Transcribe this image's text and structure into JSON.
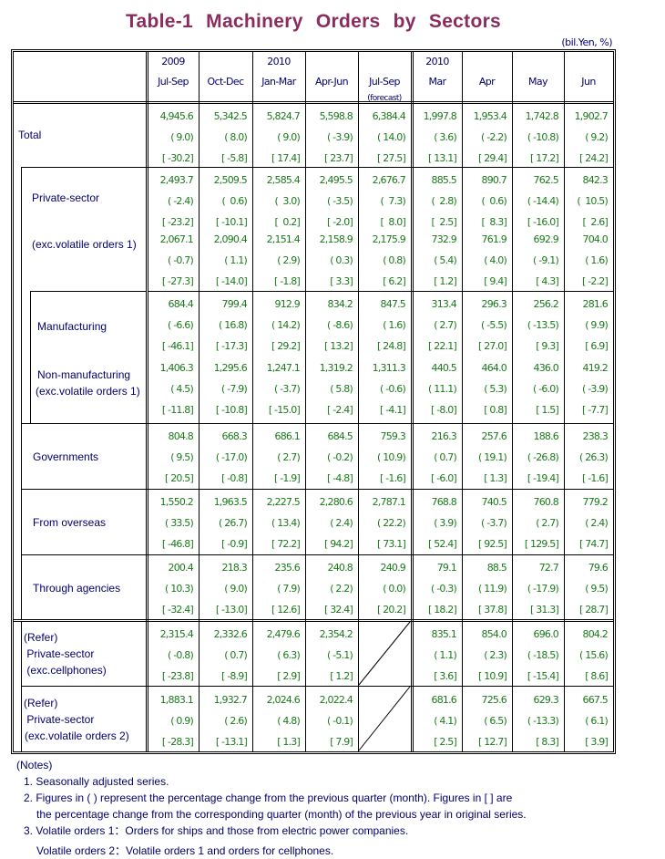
{
  "title": "Table-1  Machinery  Orders  by  Sectors",
  "units": "(bil.Yen, %)",
  "header": {
    "quarters": [
      {
        "year": "2009",
        "label": "Jul-Sep",
        "note": ""
      },
      {
        "year": "",
        "label": "Oct-Dec",
        "note": ""
      },
      {
        "year": "2010",
        "label": "Jan-Mar",
        "note": ""
      },
      {
        "year": "",
        "label": "Apr-Jun",
        "note": ""
      },
      {
        "year": "",
        "label": "Jul-Sep",
        "note": "(forecast)"
      }
    ],
    "months": [
      {
        "year": "2010",
        "label": "Mar"
      },
      {
        "year": "",
        "label": "Apr"
      },
      {
        "year": "",
        "label": "May"
      },
      {
        "year": "",
        "label": "Jun"
      }
    ]
  },
  "rows": [
    {
      "label": [
        "Total"
      ],
      "values": [
        "4,945.6",
        "5,342.5",
        "5,824.7",
        "5,598.8",
        "6,384.4",
        "1,997.8",
        "1,953.4",
        "1,742.8",
        "1,902.7"
      ],
      "qoq": [
        "( 9.0)",
        "( 8.0)",
        "( 9.0)",
        "( -3.9)",
        "( 14.0)",
        "( 3.6)",
        "( -2.2)",
        "( -10.8)",
        "( 9.2)"
      ],
      "yoy": [
        "[ -30.2]",
        "[ -5.8]",
        "[ 17.4]",
        "[ 23.7]",
        "[ 27.5]",
        "[ 13.1]",
        "[ 29.4]",
        "[ 17.2]",
        "[ 24.2]"
      ]
    },
    {
      "label": [
        "Private-sector"
      ],
      "values": [
        "2,493.7",
        "2,509.5",
        "2,585.4",
        "2,495.5",
        "2,676.7",
        "885.5",
        "890.7",
        "762.5",
        "842.3"
      ],
      "qoq": [
        "( -2.4)",
        "(  0.6)",
        "(  3.0)",
        "( -3.5)",
        "(  7.3)",
        "(  2.8)",
        "(  0.6)",
        "( -14.4)",
        "(  10.5)"
      ],
      "yoy": [
        "[ -23.2]",
        "[ -10.1]",
        "[  0.2]",
        "[ -2.0]",
        "[  8.0]",
        "[  2.5]",
        "[  8.3]",
        "[ -16.0]",
        "[  2.6]"
      ]
    },
    {
      "label": [
        "(exc.volatile orders 1)"
      ],
      "values": [
        "2,067.1",
        "2,090.4",
        "2,151.4",
        "2,158.9",
        "2,175.9",
        "732.9",
        "761.9",
        "692.9",
        "704.0"
      ],
      "qoq": [
        "( -0.7)",
        "( 1.1)",
        "( 2.9)",
        "( 0.3)",
        "( 0.8)",
        "( 5.4)",
        "( 4.0)",
        "( -9.1)",
        "( 1.6)"
      ],
      "yoy": [
        "[ -27.3]",
        "[ -14.0]",
        "[ -1.8]",
        "[ 3.3]",
        "[ 6.2]",
        "[ 1.2]",
        "[ 9.4]",
        "[ 4.3]",
        "[ -2.2]"
      ]
    },
    {
      "label": [
        "Manufacturing"
      ],
      "values": [
        "684.4",
        "799.4",
        "912.9",
        "834.2",
        "847.5",
        "313.4",
        "296.3",
        "256.2",
        "281.6"
      ],
      "qoq": [
        "( -6.6)",
        "( 16.8)",
        "( 14.2)",
        "( -8.6)",
        "( 1.6)",
        "( 2.7)",
        "( -5.5)",
        "( -13.5)",
        "( 9.9)"
      ],
      "yoy": [
        "[ -46.1]",
        "[ -17.3]",
        "[ 29.2]",
        "[ 13.2]",
        "[ 24.8]",
        "[ 22.1]",
        "[ 27.0]",
        "[ 9.3]",
        "[ 6.9]"
      ]
    },
    {
      "label": [
        "Non-manufacturing",
        "(exc.volatile orders 1)"
      ],
      "values": [
        "1,406.3",
        "1,295.6",
        "1,247.1",
        "1,319.2",
        "1,311.3",
        "440.5",
        "464.0",
        "436.0",
        "419.2"
      ],
      "qoq": [
        "( 4.5)",
        "( -7.9)",
        "( -3.7)",
        "( 5.8)",
        "( -0.6)",
        "( 11.1)",
        "( 5.3)",
        "( -6.0)",
        "( -3.9)"
      ],
      "yoy": [
        "[ -11.8]",
        "[ -10.8]",
        "[ -15.0]",
        "[ -2.4]",
        "[ -4.1]",
        "[ -8.0]",
        "[ 0.8]",
        "[ 1.5]",
        "[ -7.7]"
      ]
    },
    {
      "label": [
        "Governments"
      ],
      "values": [
        "804.8",
        "668.3",
        "686.1",
        "684.5",
        "759.3",
        "216.3",
        "257.6",
        "188.6",
        "238.3"
      ],
      "qoq": [
        "( 9.5)",
        "( -17.0)",
        "( 2.7)",
        "( -0.2)",
        "( 10.9)",
        "( 0.7)",
        "( 19.1)",
        "( -26.8)",
        "( 26.3)"
      ],
      "yoy": [
        "[ 20.5]",
        "[ -0.8]",
        "[ -1.9]",
        "[ -4.8]",
        "[ -1.6]",
        "[ -6.0]",
        "[ 1.3]",
        "[ -19.4]",
        "[ -1.6]"
      ]
    },
    {
      "label": [
        "From overseas"
      ],
      "values": [
        "1,550.2",
        "1,963.5",
        "2,227.5",
        "2,280.6",
        "2,787.1",
        "768.8",
        "740.5",
        "760.8",
        "779.2"
      ],
      "qoq": [
        "( 33.5)",
        "( 26.7)",
        "( 13.4)",
        "( 2.4)",
        "( 22.2)",
        "( 3.9)",
        "( -3.7)",
        "( 2.7)",
        "( 2.4)"
      ],
      "yoy": [
        "[ -46.8]",
        "[ -0.9]",
        "[ 72.2]",
        "[ 94.2]",
        "[ 73.1]",
        "[ 52.4]",
        "[ 92.5]",
        "[ 129.5]",
        "[ 74.7]"
      ]
    },
    {
      "label": [
        "Through agencies"
      ],
      "values": [
        "200.4",
        "218.3",
        "235.6",
        "240.8",
        "240.9",
        "79.1",
        "88.5",
        "72.7",
        "79.6"
      ],
      "qoq": [
        "( 10.3)",
        "( 9.0)",
        "( 7.9)",
        "( 2.2)",
        "( 0.0)",
        "( -0.3)",
        "( 11.9)",
        "( -17.9)",
        "( 9.5)"
      ],
      "yoy": [
        "[ -32.4]",
        "[ -13.0]",
        "[ 12.6]",
        "[ 32.4]",
        "[ 20.2]",
        "[ 18.2]",
        "[ 37.8]",
        "[ 31.3]",
        "[ 28.7]"
      ]
    },
    {
      "label": [
        "(Refer)",
        " Private-sector",
        " (exc.cellphones)"
      ],
      "values": [
        "2,315.4",
        "2,332.6",
        "2,479.6",
        "2,354.2",
        "",
        "835.1",
        "854.0",
        "696.0",
        "804.2"
      ],
      "qoq": [
        "( -0.8)",
        "( 0.7)",
        "( 6.3)",
        "( -5.1)",
        "",
        "( 1.1)",
        "( 2.3)",
        "( -18.5)",
        "( 15.6)"
      ],
      "yoy": [
        "[ -23.8]",
        "[ -8.9]",
        "[ 2.9]",
        "[ 1.2]",
        "",
        "[ 3.6]",
        "[ 10.9]",
        "[ -15.4]",
        "[ 8.6]"
      ]
    },
    {
      "label": [
        "(Refer)",
        " Private-sector",
        "(exc.volatile orders 2)"
      ],
      "values": [
        "1,883.1",
        "1,932.7",
        "2,024.6",
        "2,022.4",
        "",
        "681.6",
        "725.6",
        "629.3",
        "667.5"
      ],
      "qoq": [
        "( 0.9)",
        "( 2.6)",
        "( 4.8)",
        "( -0.1)",
        "",
        "( 4.1)",
        "( 6.5)",
        "( -13.3)",
        "( 6.1)"
      ],
      "yoy": [
        "[ -28.3]",
        "[ -13.1]",
        "[ 1.3]",
        "[ 7.9]",
        "",
        "[ 2.5]",
        "[ 12.7]",
        "[ 8.3]",
        "[ 3.9]"
      ]
    }
  ],
  "notes": {
    "heading": "(Notes)",
    "items": [
      "1. Seasonally adjusted series.",
      "2. Figures in ( ) represent the percentage change from the previous quarter (month). Figures in [ ] are",
      "the percentage change from the corresponding quarter (month) of the previous year in original series.",
      "3. Volatile orders 1：Orders for ships and those from electric power companies.",
      "Volatile orders 2：Volatile orders 1 and orders for cellphones."
    ]
  }
}
